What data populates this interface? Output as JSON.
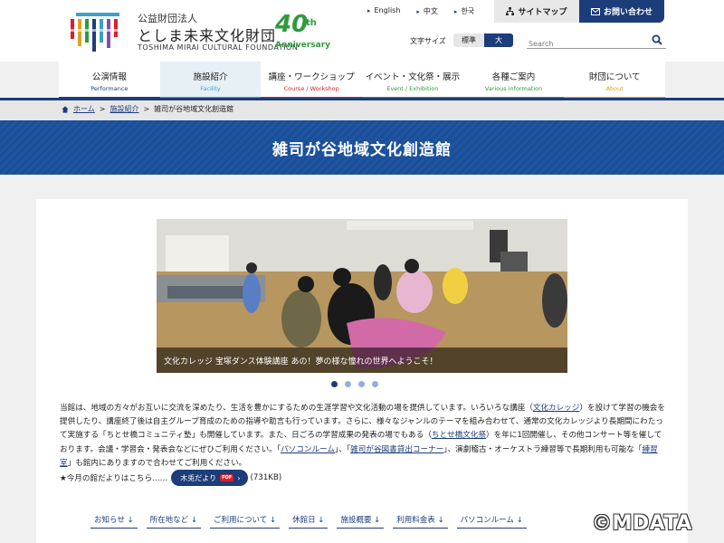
{
  "header": {
    "org_type": "公益財団法人",
    "org_name": "としま未来文化財団",
    "org_name_en": "TOSHIMA MIRAI CULTURAL FOUNDATION",
    "anniversary_number": "40",
    "anniversary_suffix": "th",
    "anniversary_label": "Anniversary",
    "languages": [
      "English",
      "中文",
      "한국"
    ],
    "sitemap_label": "サイトマップ",
    "contact_label": "お問い合わせ",
    "font_size_label": "文字サイズ",
    "font_size_standard": "標準",
    "font_size_large": "大",
    "search_placeholder": "Search"
  },
  "nav": {
    "items": [
      {
        "label": "公演情報",
        "sub": "Performance",
        "color": "#1c3d7a"
      },
      {
        "label": "施設紹介",
        "sub": "Facility",
        "color": "#3ea0c8"
      },
      {
        "label": "講座・ワークショップ",
        "sub": "Course / Workshop",
        "color": "#d9202a"
      },
      {
        "label": "イベント・文化祭・展示",
        "sub": "Event / Exhibition",
        "color": "#2e9a3d"
      },
      {
        "label": "各種ご案内",
        "sub": "Various information",
        "color": "#2e9a3d"
      },
      {
        "label": "財団について",
        "sub": "About",
        "color": "#e0a020"
      }
    ],
    "active_index": 1
  },
  "breadcrumb": {
    "home": "ホーム",
    "parent": "施設紹介",
    "current": "雑司が谷地域文化創造館"
  },
  "page_title": "雑司が谷地域文化創造館",
  "slider": {
    "caption": "文化カレッジ 宝塚ダンス体験講座 あの！夢の様な憧れの世界へようこそ！",
    "dot_count": 4,
    "active_dot": 0
  },
  "description": {
    "p1": "当館は、地域の方々がお互いに交流を深めたり、生活を豊かにするための生涯学習や文化活動の場を提供しています。いろいろな講座（",
    "link_college": "文化カレッジ",
    "p2": "）を設けて学習の機会を提供したり、講座終了後は自主グループ育成のための指導や助言も行っています。さらに、様々なジャンルのテーマを組み合わせて、通常の文化カレッジより長期間にわたって実施する「ちとせ橋コミュニティ塾」も開催しています。また、日ごろの学習成果の発表の場でもある（",
    "link_festival": "ちとせ橋文化祭",
    "p3": "）を年に1回開催し、その他コンサート等を催しております。会議・学習会・発表会などにぜひご利用ください。「",
    "link_pc": "パソコンルーム",
    "p4": "」、「",
    "link_library": "雑司が谷図書貸出コーナー",
    "p5": "」、演劇稽古・オーケストラ練習等で長期利用も可能な「",
    "link_practice": "練習室",
    "p6": "」も館内にありますので合わせてご利用ください。"
  },
  "newsletter": {
    "prefix": "★今月の館だよりはこちら……",
    "button_label": "木兎だより",
    "pdf_badge": "PDF",
    "size": "(731KB)"
  },
  "anchors": [
    "お知らせ",
    "所在地など",
    "ご利用について",
    "休館日",
    "施設概要",
    "利用料金表",
    "パソコンルーム"
  ],
  "copyright": "©MDATA"
}
